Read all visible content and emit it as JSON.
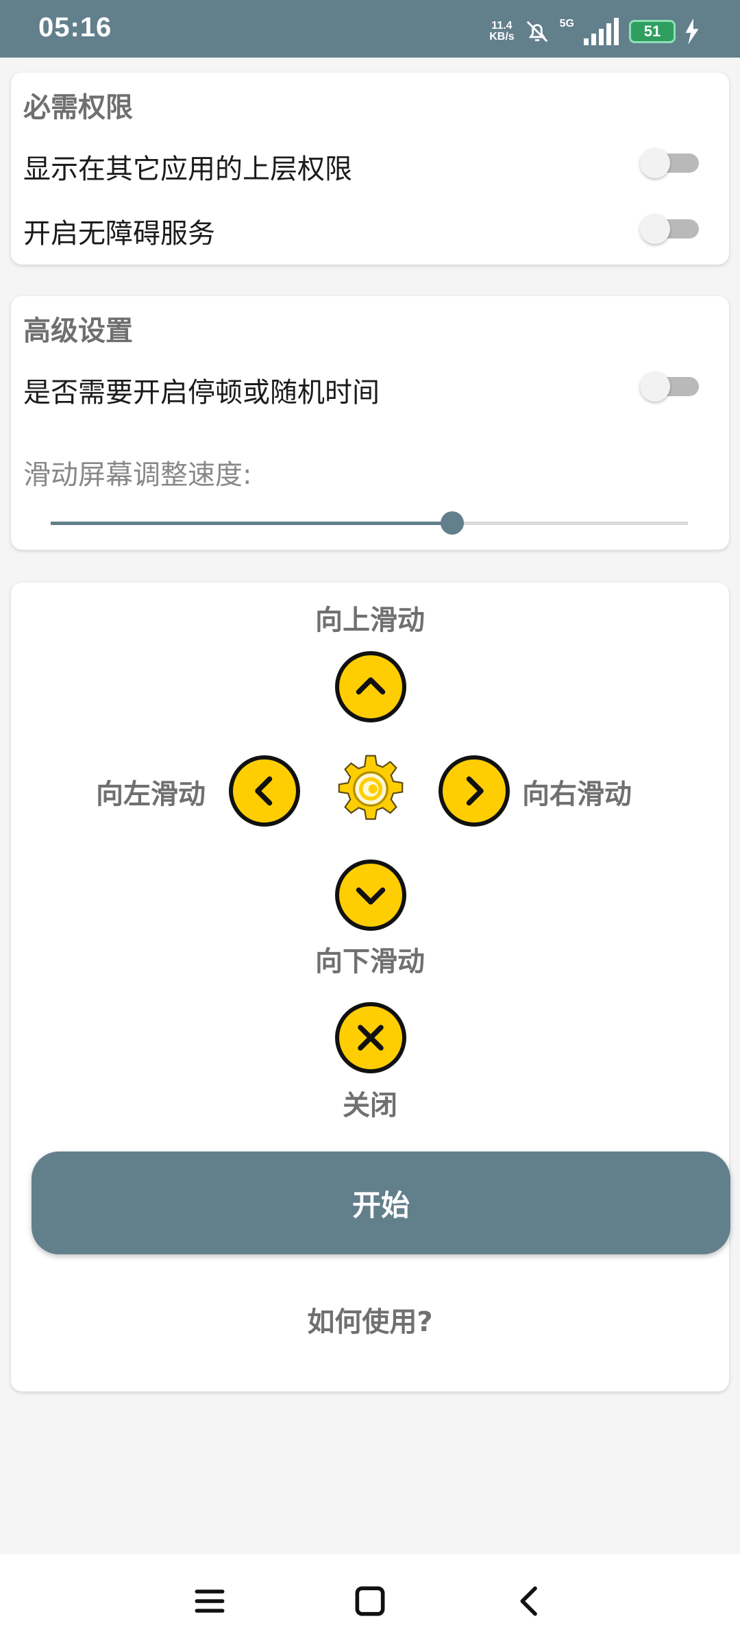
{
  "status_bar": {
    "time": "05:16",
    "net_speed_value": "11.4",
    "net_speed_unit": "KB/s",
    "signal_type": "5G",
    "battery": "51",
    "icons": [
      "mute-bell-icon",
      "signal-icon",
      "battery-icon",
      "charging-icon"
    ]
  },
  "permissions": {
    "title": "必需权限",
    "items": [
      {
        "label": "显示在其它应用的上层权限",
        "enabled": false
      },
      {
        "label": "开启无障碍服务",
        "enabled": false
      }
    ]
  },
  "advanced": {
    "title": "高级设置",
    "pause_random_label": "是否需要开启停顿或随机时间",
    "pause_random_enabled": false,
    "speed_label": "滑动屏幕调整速度:",
    "speed_value": 0.63
  },
  "controls": {
    "up": "向上滑动",
    "left": "向左滑动",
    "right": "向右滑动",
    "down": "向下滑动",
    "close": "关闭",
    "accent_color": "#fece02"
  },
  "actions": {
    "start": "开始",
    "help": "如何使用?"
  },
  "theme": {
    "primary": "#627f8c",
    "background": "#f5f5f6"
  }
}
